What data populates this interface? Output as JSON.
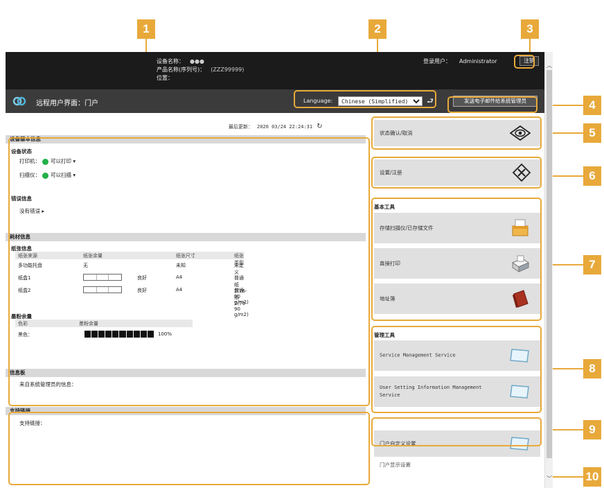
{
  "header": {
    "device_name_label": "设备名称：",
    "device_name_value": "●●●",
    "product_name_label": "产品名称(序列号)：",
    "product_name_value": "(ZZZ99999)",
    "location_label": "位置：",
    "login_user_label": "登录用户：",
    "login_user_value": "Administrator",
    "logout_label": "注销"
  },
  "titlebar": {
    "title": "远程用户界面：门户",
    "language_label": "Language:",
    "language_value": "Chinese (Simplified)",
    "mail_button_label": "发送电子邮件给系统管理员"
  },
  "update": {
    "label": "最后更新：",
    "value": "2020 03/24 22:24:31"
  },
  "device_info": {
    "title": "设备基本信息",
    "status_heading": "设备状态",
    "printer_label": "打印机：",
    "printer_status": "可以打印",
    "scanner_label": "扫描仪：",
    "scanner_status": "可以扫描",
    "error_heading": "错误信息",
    "error_value": "没有错误"
  },
  "consumables": {
    "title": "耗材信息",
    "paper_heading": "纸张信息",
    "columns": [
      "纸张来源",
      "纸张余量",
      "纸张尺寸",
      "纸张类型"
    ],
    "rows": [
      {
        "source": "多功能托盘",
        "remaining": "无",
        "size": "未知",
        "type": "未定义"
      },
      {
        "source": "纸盒1",
        "remaining": "良好",
        "size": "A4",
        "type": "普通纸2(76-90 g/m2)"
      },
      {
        "source": "纸盒2",
        "remaining": "良好",
        "size": "A4",
        "type": "普通纸2(76-90 g/m2)"
      }
    ],
    "toner_heading": "墨粉余量",
    "toner_columns": [
      "色彩",
      "墨粉余量"
    ],
    "toner_row": {
      "color": "黑色：",
      "percent": "100%",
      "level": 1.0
    }
  },
  "messages": {
    "title": "信息板",
    "row": "来自系统管理员的信息："
  },
  "support": {
    "title": "支持链接",
    "row": "支持链接："
  },
  "right_panel": {
    "status_button": "状态确认/取消",
    "settings_button": "设置/注册",
    "basic_tools_heading": "基本工具",
    "basic_tools": [
      "存储扫描仪/已存储文件",
      "直接打印",
      "地址簿"
    ],
    "mgmt_tools_heading": "管理工具",
    "mgmt_tools": [
      "Service Management Service",
      "User Setting Information Management Service"
    ],
    "custom_button": "门户自定义设置",
    "portal_display_link": "门户显示设置"
  },
  "callouts": [
    "1",
    "2",
    "3",
    "4",
    "5",
    "6",
    "7",
    "8",
    "9",
    "10"
  ],
  "colors": {
    "accent": "#e8a93a",
    "status_green": "#22b04b",
    "header": "#1b1b1b"
  }
}
